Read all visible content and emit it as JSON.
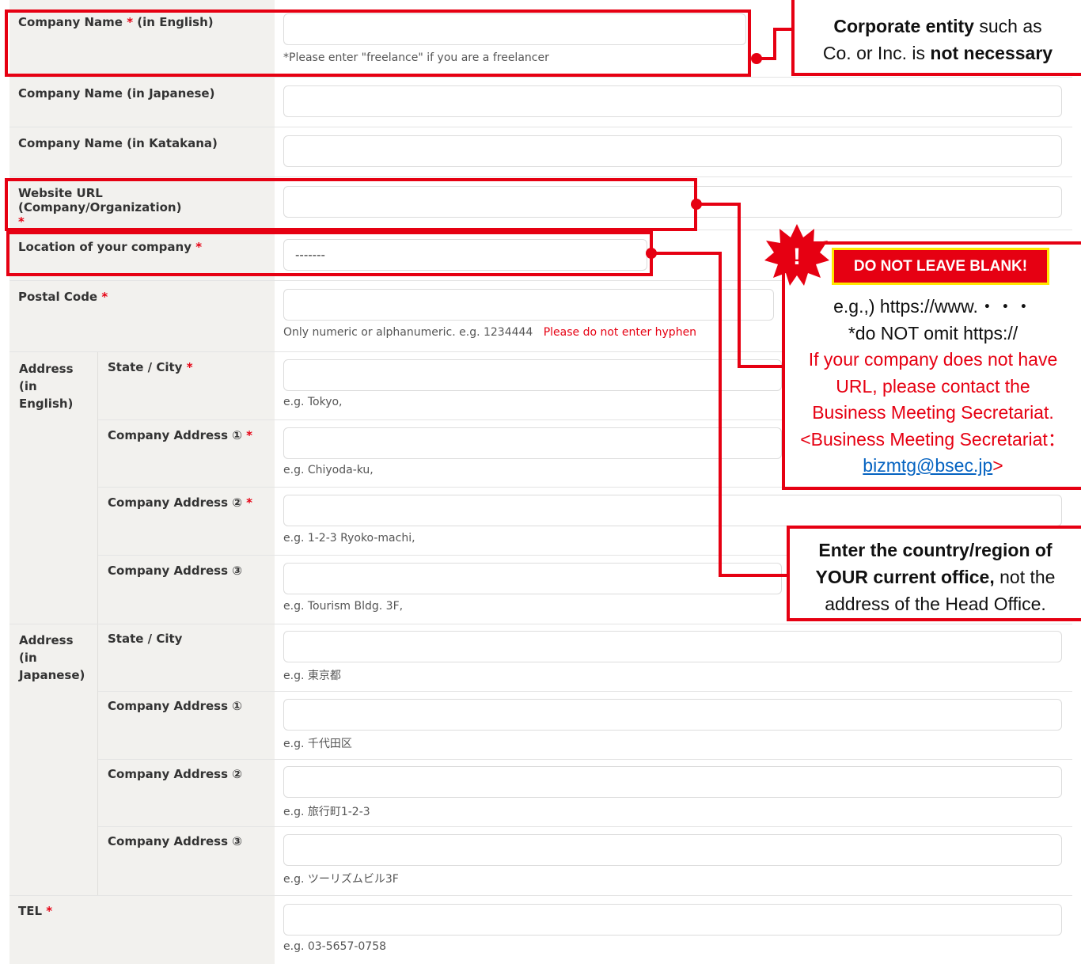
{
  "form": {
    "company_name_en": {
      "label": "Company Name",
      "req": "*",
      "suffix": "(in English)",
      "help": "*Please enter \"freelance\" if you are a freelancer"
    },
    "company_name_jp": {
      "label": "Company Name (in Japanese)"
    },
    "company_name_kana": {
      "label": "Company Name (in Katakana)"
    },
    "website": {
      "label": "Website URL (Company/Organization)",
      "req": "*"
    },
    "location": {
      "label": "Location of your company",
      "req": "*",
      "value": "-------"
    },
    "postal": {
      "label": "Postal Code",
      "req": "*",
      "help": "Only numeric or alphanumeric. e.g. 1234444",
      "help_warn": "Please do not enter hyphen"
    },
    "address_en": {
      "group_label": "Address (in English)",
      "fields": [
        {
          "label": "State / City",
          "req": "*",
          "help": "e.g. Tokyo,"
        },
        {
          "label": "Company Address ①",
          "req": "*",
          "help": "e.g. Chiyoda-ku,"
        },
        {
          "label": "Company Address ②",
          "req": "*",
          "help": "e.g. 1-2-3 Ryoko-machi,"
        },
        {
          "label": "Company Address ③",
          "req": "",
          "help": "e.g. Tourism Bldg. 3F,"
        }
      ]
    },
    "address_jp": {
      "group_label": "Address (in Japanese)",
      "fields": [
        {
          "label": "State / City",
          "help": "e.g. 東京都"
        },
        {
          "label": "Company Address ①",
          "help": "e.g. 千代田区"
        },
        {
          "label": "Company Address ②",
          "help": "e.g. 旅行町1-2-3"
        },
        {
          "label": "Company Address ③",
          "help": "e.g. ツーリズムビル3F"
        }
      ]
    },
    "tel": {
      "label": "TEL",
      "req": "*",
      "help": "e.g. 03-5657-0758"
    }
  },
  "callouts": {
    "corporate": {
      "b1": "Corporate entity",
      "t1": " such as",
      "t2": "Co. or Inc. is ",
      "b2": "not necessary"
    },
    "warning": {
      "icon": "!",
      "badge": "DO NOT LEAVE BLANK!",
      "line1": "e.g.,) https://www.・・・",
      "line2": "*do NOT omit https://",
      "red1": "If your company does not have",
      "red2": "URL, please contact the",
      "red3": "Business Meeting Secretariat.",
      "red4": "<Business Meeting Secretariat：",
      "email": "bizmtg@bsec.jp",
      "close": ">"
    },
    "location": {
      "b1": "Enter the country/region of",
      "b2": "YOUR current office,",
      "t1": " not the",
      "t2": "address of the Head Office."
    }
  },
  "colors": {
    "accent": "#e60012",
    "label_bg": "#f2f1ee",
    "badge_bg": "#e60012",
    "badge_border": "#ffe600",
    "link": "#0563c1"
  }
}
